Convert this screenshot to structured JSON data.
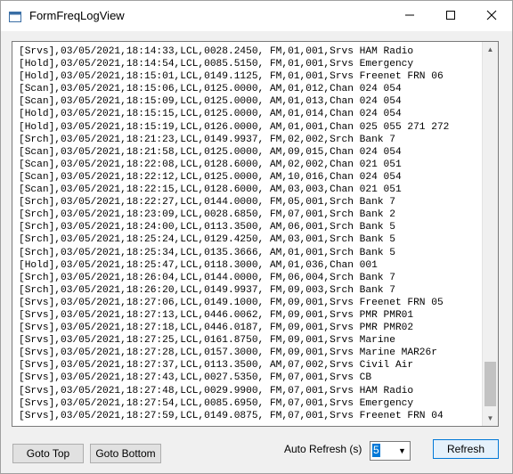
{
  "window": {
    "title": "FormFreqLogView",
    "minimize_icon": "minimize-icon",
    "maximize_icon": "maximize-icon",
    "close_icon": "close-icon"
  },
  "log": {
    "lines": [
      "[Srvs],03/05/2021,18:14:33,LCL,0028.2450, FM,01,001,Srvs HAM Radio",
      "[Hold],03/05/2021,18:14:54,LCL,0085.5150, FM,01,001,Srvs Emergency",
      "[Hold],03/05/2021,18:15:01,LCL,0149.1125, FM,01,001,Srvs Freenet FRN 06",
      "[Scan],03/05/2021,18:15:06,LCL,0125.0000, AM,01,012,Chan 024 054",
      "[Scan],03/05/2021,18:15:09,LCL,0125.0000, AM,01,013,Chan 024 054",
      "[Hold],03/05/2021,18:15:15,LCL,0125.0000, AM,01,014,Chan 024 054",
      "[Hold],03/05/2021,18:15:19,LCL,0126.0000, AM,01,001,Chan 025 055 271 272",
      "[Srch],03/05/2021,18:21:23,LCL,0149.9937, FM,02,002,Srch Bank 7",
      "[Scan],03/05/2021,18:21:58,LCL,0125.0000, AM,09,015,Chan 024 054",
      "[Scan],03/05/2021,18:22:08,LCL,0128.6000, AM,02,002,Chan 021 051",
      "[Scan],03/05/2021,18:22:12,LCL,0125.0000, AM,10,016,Chan 024 054",
      "[Scan],03/05/2021,18:22:15,LCL,0128.6000, AM,03,003,Chan 021 051",
      "[Srch],03/05/2021,18:22:27,LCL,0144.0000, FM,05,001,Srch Bank 7",
      "[Srch],03/05/2021,18:23:09,LCL,0028.6850, FM,07,001,Srch Bank 2",
      "[Srch],03/05/2021,18:24:00,LCL,0113.3500, AM,06,001,Srch Bank 5",
      "[Srch],03/05/2021,18:25:24,LCL,0129.4250, AM,03,001,Srch Bank 5",
      "[Srch],03/05/2021,18:25:34,LCL,0135.3666, AM,01,001,Srch Bank 5",
      "[Hold],03/05/2021,18:25:47,LCL,0118.3000, AM,01,036,Chan 001",
      "[Srch],03/05/2021,18:26:04,LCL,0144.0000, FM,06,004,Srch Bank 7",
      "[Srch],03/05/2021,18:26:20,LCL,0149.9937, FM,09,003,Srch Bank 7",
      "[Srvs],03/05/2021,18:27:06,LCL,0149.1000, FM,09,001,Srvs Freenet FRN 05",
      "[Srvs],03/05/2021,18:27:13,LCL,0446.0062, FM,09,001,Srvs PMR PMR01",
      "[Srvs],03/05/2021,18:27:18,LCL,0446.0187, FM,09,001,Srvs PMR PMR02",
      "[Srvs],03/05/2021,18:27:25,LCL,0161.8750, FM,09,001,Srvs Marine",
      "[Srvs],03/05/2021,18:27:28,LCL,0157.3000, FM,09,001,Srvs Marine MAR26r",
      "[Srvs],03/05/2021,18:27:37,LCL,0113.3500, AM,07,002,Srvs Civil Air",
      "[Srvs],03/05/2021,18:27:43,LCL,0027.5350, FM,07,001,Srvs CB",
      "[Srvs],03/05/2021,18:27:48,LCL,0029.9900, FM,07,001,Srvs HAM Radio",
      "[Srvs],03/05/2021,18:27:54,LCL,0085.6950, FM,07,001,Srvs Emergency",
      "[Srvs],03/05/2021,18:27:59,LCL,0149.0875, FM,07,001,Srvs Freenet FRN 04"
    ]
  },
  "controls": {
    "goto_top": "Goto Top",
    "goto_bottom": "Goto Bottom",
    "auto_refresh_label": "Auto Refresh (s)",
    "auto_refresh_value": "5",
    "refresh": "Refresh"
  }
}
